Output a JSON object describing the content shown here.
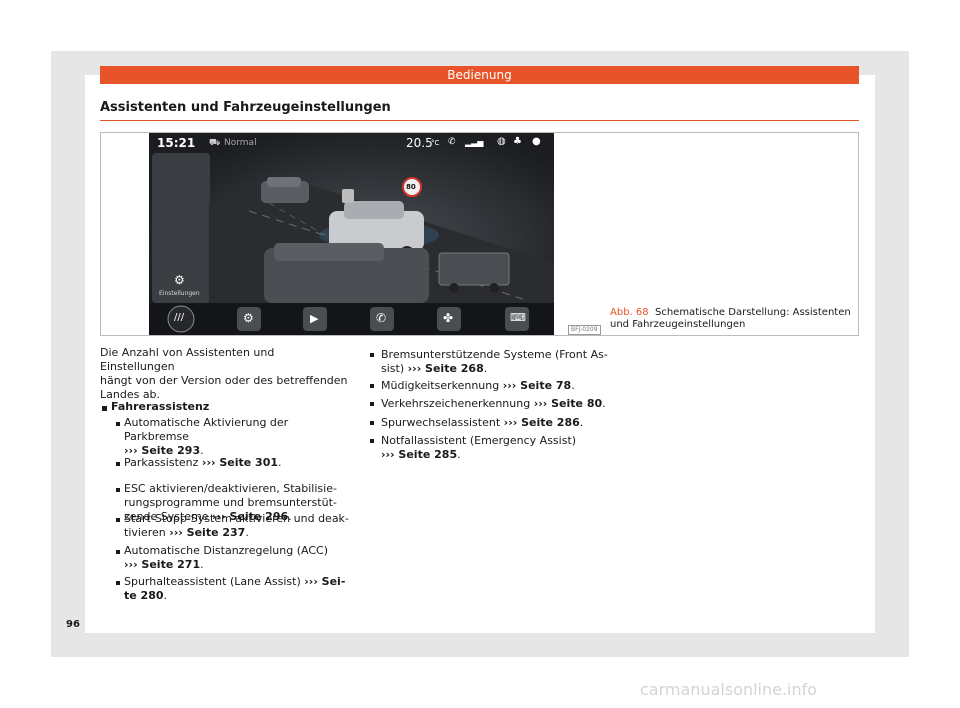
{
  "header": {
    "chapter": "Bedienung"
  },
  "section_title": "Assistenten und Fahrzeugeinstellungen",
  "figure": {
    "screen": {
      "time": "15:21",
      "drive_mode": "Normal",
      "temperature": "20.5",
      "temp_unit": "°C",
      "speed_sign": "80",
      "settings_label": "Einstellungen"
    },
    "code": "BFJ-0209",
    "caption_label": "Abb. 68",
    "caption_text": "Schematische Darstellung: Assistenten und Fahrzeugeinstellungen"
  },
  "intro": [
    "Die Anzahl von Assistenten und Einstellungen",
    "hängt von der Version oder des betreffenden",
    "Landes ab."
  ],
  "group_title": "Fahrerassistenz",
  "sub_items": [
    {
      "lines": [
        "Automatische Aktivierung der Parkbremse"
      ],
      "ref": "››› Seite 293",
      "ref_inline": false
    },
    {
      "lines": [
        "Parkassistenz"
      ],
      "ref": "››› Seite 301",
      "ref_inline": true
    },
    {
      "lines": [
        "ESC aktivieren/deaktivieren, Stabilisie-",
        "rungsprogramme und bremsunterstüt-",
        "zende Systeme"
      ],
      "ref": "››› Seite 296",
      "ref_inline": true
    },
    {
      "lines": [
        "Start-Stopp-System aktivieren und deak-",
        "tivieren"
      ],
      "ref": "››› Seite 237",
      "ref_inline": true
    },
    {
      "lines": [
        "Automatische Distanzregelung (ACC)"
      ],
      "ref": "››› Seite 271",
      "ref_inline": false
    },
    {
      "lines": [
        "Spurhalteassistent (Lane Assist)"
      ],
      "ref": "››› Sei-",
      "ref_inline": true,
      "ref_cont": "te 280"
    }
  ],
  "right_items": [
    {
      "lines": [
        "Bremsunterstützende Systeme (Front As-",
        "sist)"
      ],
      "ref": "››› Seite 268"
    },
    {
      "lines": [
        "Müdigkeitserkennung"
      ],
      "ref": "››› Seite 78"
    },
    {
      "lines": [
        "Verkehrszeichenerkennung"
      ],
      "ref": "››› Seite 80"
    },
    {
      "lines": [
        "Spurwechselassistent"
      ],
      "ref": "››› Seite 286"
    },
    {
      "lines": [
        "Notfallassistent (Emergency Assist)"
      ],
      "ref": "››› Seite 285"
    }
  ],
  "page_number": "96",
  "watermark": "carmanualsonline.info",
  "colors": {
    "accent": "#e8542a",
    "screen_bg": "#1b1d20"
  }
}
